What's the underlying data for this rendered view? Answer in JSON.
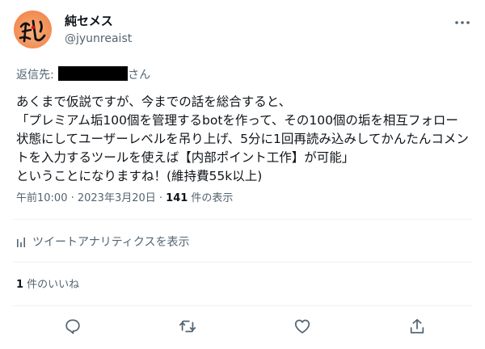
{
  "tweet": {
    "display_name": "純セメス",
    "handle": "@jyunreaist",
    "reply_to": {
      "prefix": "返信先: ",
      "suffix": "さん"
    },
    "body": "あくまで仮説ですが、今までの話を総合すると、\n「プレミアム垢100個を管理するbotを作って、その100個の垢を相互フォロー状態にしてユーザーレベルを吊り上げ、5分に1回再読み込みしてかんたんコメントを入力するツールを使えば【内部ポイント工作】が可能」\nということになりますね！(維持費55k以上)",
    "timestamp": "午前10:00 · 2023年3月20日 · ",
    "views_count": "141",
    "views_label": " 件の表示",
    "analytics_label": "ツイートアナリティクスを表示",
    "likes_count": "1",
    "likes_label": " 件のいいね"
  },
  "icons": {
    "avatar": "avatar-calligraphy",
    "more": "more-horizontal-icon",
    "analytics": "analytics-bar-icon",
    "reply": "reply-icon",
    "retweet": "retweet-icon",
    "like": "heart-icon",
    "share": "share-icon"
  },
  "colors": {
    "text": "#0f1419",
    "secondary": "#536471",
    "divider": "#eff3f4",
    "avatar_bg": "#f3925a"
  }
}
